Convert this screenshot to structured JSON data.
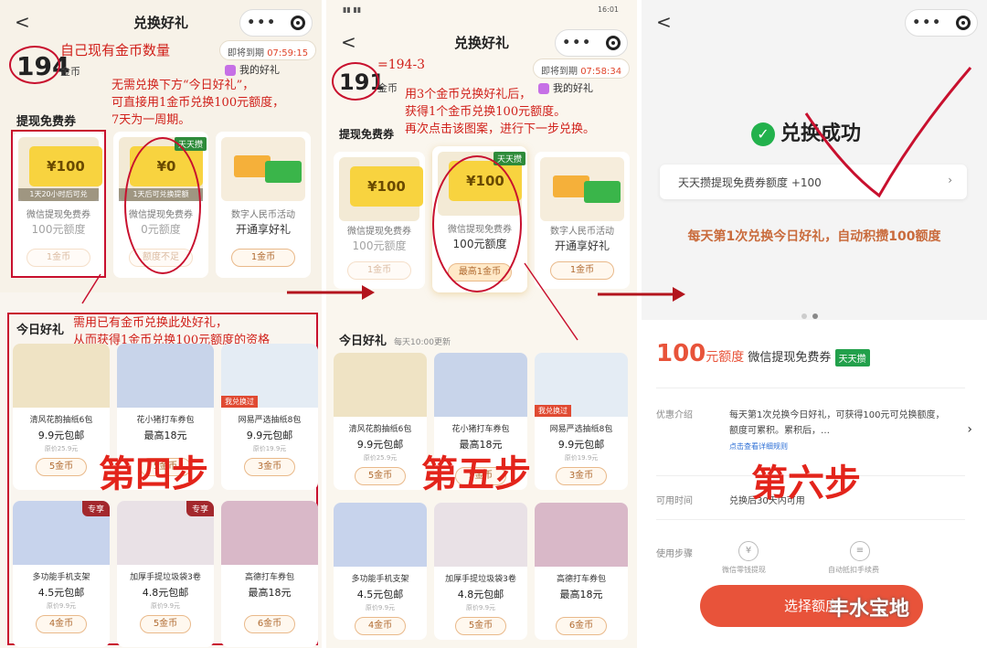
{
  "header": {
    "title": "兑换好礼",
    "back": "<"
  },
  "p1": {
    "coins": "194",
    "coin_unit": "金币",
    "expire_label": "即将到期",
    "expire_time": "07:59:15",
    "my_gift": "我的好礼",
    "section_cash": "提现免费券",
    "cards": [
      {
        "img": "¥100",
        "sub": "1天20小时后可兑",
        "name": "微信提现免费券",
        "amount": "100元额度",
        "btn": "1金币"
      },
      {
        "img": "¥0",
        "sub": "1天后可兑换提额",
        "name": "微信提现免费券",
        "amount": "0元额度",
        "btn": "额度不足",
        "badge": "天天攒"
      },
      {
        "img": "",
        "sub": "",
        "name": "数字人民币活动",
        "amount": "开通享好礼",
        "btn": "1金币"
      }
    ],
    "section_today": "今日好礼",
    "products": [
      {
        "name": "清风花韵抽纸6包",
        "price": "9.9元包邮",
        "orig": "原价25.9元",
        "btn": "5金币"
      },
      {
        "name": "花小猪打车券包",
        "price": "最高18元",
        "orig": "",
        "btn": "5金币"
      },
      {
        "name": "网易严选抽纸8包",
        "price": "9.9元包邮",
        "orig": "原价19.9元",
        "btn": "3金币",
        "tag": "我兑换过"
      },
      {
        "name": "多功能手机支架",
        "price": "4.5元包邮",
        "orig": "原价9.9元",
        "btn": "4金币",
        "tag": "专享"
      },
      {
        "name": "加厚手提垃圾袋3卷",
        "price": "4.8元包邮",
        "orig": "原价9.9元",
        "btn": "5金币",
        "tag": "专享"
      },
      {
        "name": "高德打车券包",
        "price": "最高18元",
        "orig": "",
        "btn": "6金币"
      }
    ],
    "notes": {
      "coins": "自己现有金币数量",
      "tip1": "无需兑换下方“今日好礼”，",
      "tip2": "可直接用1金币兑换100元额度，",
      "tip3": "7天为一周期。",
      "need1": "需用已有金币兑换此处好礼，",
      "need2": "从而获得1金币兑换100元额度的资格",
      "step": "第四步"
    }
  },
  "p2": {
    "coins": "191",
    "coin_unit": "金币",
    "expire_label": "即将到期",
    "expire_time": "07:58:34",
    "my_gift": "我的好礼",
    "time": "16:01",
    "section_cash": "提现免费券",
    "section_today": "今日好礼",
    "today_sub": "每天10:00更新",
    "cards": [
      {
        "img": "¥100",
        "name": "微信提现免费券",
        "amount": "100元额度",
        "btn": "1金币"
      },
      {
        "img": "¥100",
        "name": "微信提现免费券",
        "amount": "100元额度",
        "btn": "最高1金币",
        "badge": "天天攒"
      },
      {
        "img": "",
        "name": "数字人民币活动",
        "amount": "开通享好礼",
        "btn": "1金币"
      }
    ],
    "products": [
      {
        "name": "清风花韵抽纸6包",
        "price": "9.9元包邮",
        "orig": "原价25.9元",
        "btn": "5金币"
      },
      {
        "name": "花小猪打车券包",
        "price": "最高18元",
        "orig": "",
        "btn": "5金币"
      },
      {
        "name": "网易严选抽纸8包",
        "price": "9.9元包邮",
        "orig": "原价19.9元",
        "btn": "3金币",
        "tag": "我兑换过"
      },
      {
        "name": "多功能手机支架",
        "price": "4.5元包邮",
        "orig": "原价9.9元",
        "btn": "4金币"
      },
      {
        "name": "加厚手提垃圾袋3卷",
        "price": "4.8元包邮",
        "orig": "原价9.9元",
        "btn": "5金币"
      },
      {
        "name": "高德打车券包",
        "price": "最高18元",
        "orig": "",
        "btn": "6金币"
      }
    ],
    "notes": {
      "calc": "=194-3",
      "a1": "用3个金币兑换好礼后，",
      "a2": "获得1个金币兑换100元额度。",
      "a3": "再次点击该图案，进行下一步兑换。",
      "step": "第五步"
    }
  },
  "p3": {
    "success": "兑换成功",
    "bar": "天天攒提现免费券额度 +100",
    "daily": "每天第1次兑换今日好礼，自动积攒100额度",
    "amount": "100",
    "amount_unit": "元额度",
    "amount_desc": "微信提现免费券",
    "tag": "天天攒",
    "intro_label": "优惠介绍",
    "intro": "每天第1次兑换今日好礼，可获得100元可兑换额度，额度可累积。累积后，…",
    "intro_link": "点击查看详细规则",
    "time_label": "可用时间",
    "time": "兑换后30天内可用",
    "steps_label": "使用步骤",
    "step1": "微信零钱提现",
    "step2": "自动抵扣手续费",
    "btn": "选择额度",
    "watermark": "丰水宝地",
    "step": "第六步"
  },
  "colors": {
    "accent": "#e8533a",
    "note": "#d0201a",
    "gold": "#f8d33f",
    "green": "#22b14c"
  }
}
